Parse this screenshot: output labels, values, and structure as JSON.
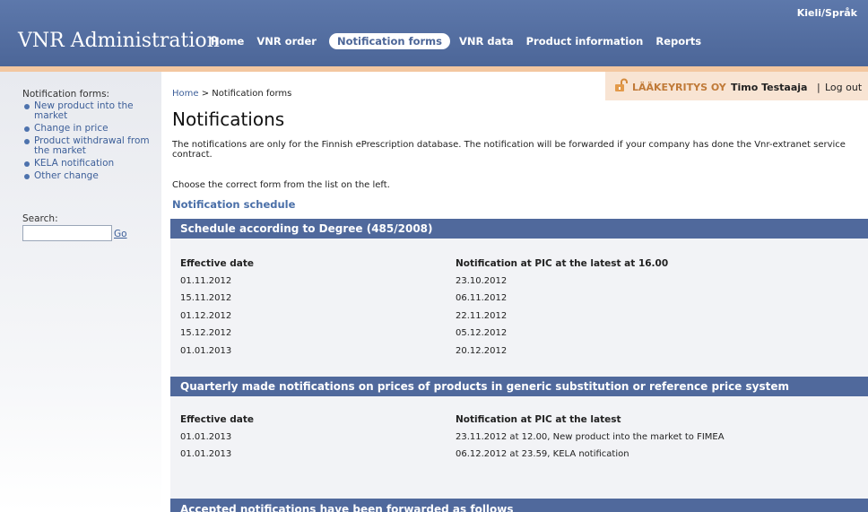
{
  "header": {
    "app_title": "VNR Administration",
    "lang_link": "Kieli/Språk",
    "nav": [
      {
        "label": "Home"
      },
      {
        "label": "VNR order"
      },
      {
        "label": "Notification forms"
      },
      {
        "label": "VNR data"
      },
      {
        "label": "Product information"
      },
      {
        "label": "Reports"
      }
    ],
    "active_nav": "Notification forms"
  },
  "user_box": {
    "company": "LÄÄKEYRITYS OY",
    "user": "Timo Testaaja",
    "separator": "|",
    "logout": "Log out"
  },
  "sidebar": {
    "heading": "Notification forms:",
    "items": [
      {
        "label": "New product into the market"
      },
      {
        "label": "Change in price"
      },
      {
        "label": "Product withdrawal from the market"
      },
      {
        "label": "KELA notification"
      },
      {
        "label": "Other change"
      }
    ],
    "search_label": "Search:",
    "search_value": "",
    "go_label": "Go"
  },
  "breadcrumb": {
    "home": "Home",
    "separator": ">",
    "current": "Notification forms"
  },
  "main": {
    "title": "Notifications",
    "intro": "The notifications are only for the Finnish ePrescription database. The notification will be forwarded if your company has done the Vnr-extranet service contract.",
    "choose_text": "Choose the correct form from the list on the left.",
    "schedule_link": "Notification schedule",
    "sections": [
      {
        "title": "Schedule according to Degree (485/2008)",
        "columns": [
          "Effective date",
          "Notification at PIC at the latest at 16.00"
        ],
        "rows": [
          [
            "01.11.2012",
            "23.10.2012"
          ],
          [
            "15.11.2012",
            "06.11.2012"
          ],
          [
            "01.12.2012",
            "22.11.2012"
          ],
          [
            "15.12.2012",
            "05.12.2012"
          ],
          [
            "01.01.2013",
            "20.12.2012"
          ]
        ]
      },
      {
        "title": "Quarterly made notifications on prices of products in generic substitution or reference price system",
        "columns": [
          "Effective date",
          "Notification at PIC at the latest"
        ],
        "rows": [
          [
            "01.01.2013",
            "23.11.2012 at 12.00, New product into the market to FIMEA"
          ],
          [
            "01.01.2013",
            "06.12.2012 at 23.59, KELA notification"
          ]
        ]
      },
      {
        "title": "Accepted notifications have been forwarded as follows"
      }
    ]
  },
  "colors": {
    "header_bg": "#50699c",
    "accent_link": "#3d5f99",
    "company_color": "#c07a38",
    "user_box_bg": "#f8e4d3",
    "peach_strip": "#f3c7a0"
  },
  "icons": {
    "lock": "unlocked-padlock-icon",
    "bullet": "bullet-dot-icon"
  }
}
